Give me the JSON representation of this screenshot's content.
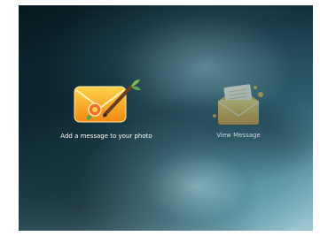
{
  "menu": {
    "add_message_label": "Add a message to your photo",
    "view_message_label": "View Message",
    "add_message_icon": "envelope-with-pen-icon",
    "view_message_icon": "open-envelope-letter-icon"
  },
  "colors": {
    "envelope_orange": "#f2a21e",
    "envelope_yellow": "#f7d047",
    "background_dark": "#0f2e3a",
    "background_light": "#9fcad3"
  }
}
